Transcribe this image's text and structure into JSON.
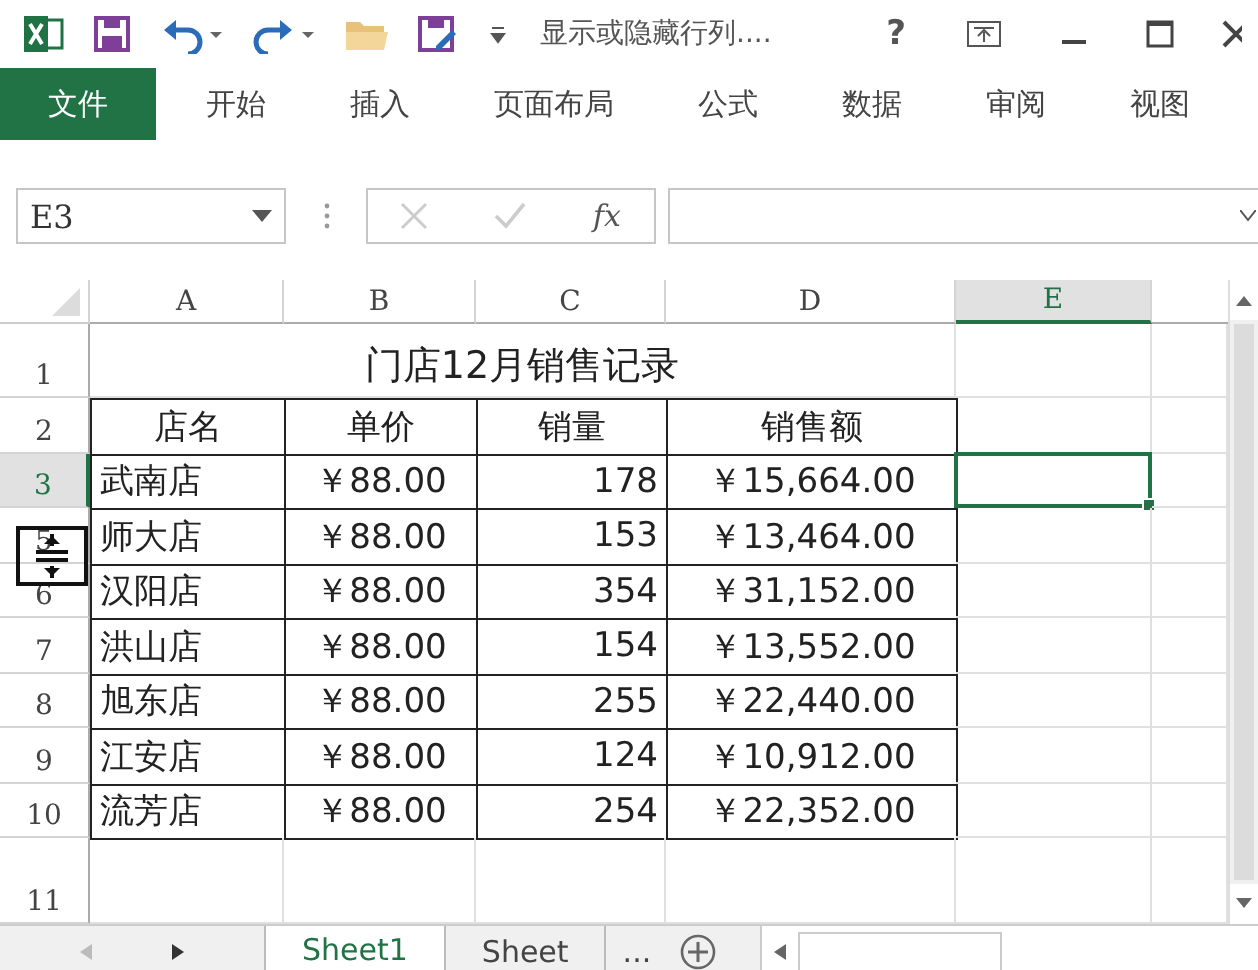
{
  "title_bar": {
    "title": "显示或隐藏行列....",
    "help": "?"
  },
  "ribbon_tabs": [
    {
      "label": "文件",
      "kind": "file",
      "selected": false
    },
    {
      "label": "开始",
      "kind": "tab",
      "selected": false
    },
    {
      "label": "插入",
      "kind": "tab",
      "selected": false
    },
    {
      "label": "页面布局",
      "kind": "tab",
      "selected": false
    },
    {
      "label": "公式",
      "kind": "tab",
      "selected": false
    },
    {
      "label": "数据",
      "kind": "tab",
      "selected": false
    },
    {
      "label": "审阅",
      "kind": "tab",
      "selected": false
    },
    {
      "label": "视图",
      "kind": "tab",
      "selected": false
    }
  ],
  "formula_bar": {
    "name_box": "E3",
    "function_label": "fx"
  },
  "columns": [
    {
      "label": "A",
      "selected": false
    },
    {
      "label": "B",
      "selected": false
    },
    {
      "label": "C",
      "selected": false
    },
    {
      "label": "D",
      "selected": false
    },
    {
      "label": "E",
      "selected": true
    }
  ],
  "rows": [
    {
      "header": "1",
      "selected": false,
      "title": "门店12月销售记录"
    },
    {
      "header": "2",
      "selected": false,
      "kind": "head",
      "cells": [
        "店名",
        "单价",
        "销量",
        "销售额"
      ]
    },
    {
      "header": "3",
      "selected": true,
      "cells": [
        "武南店",
        "￥88.00",
        "178",
        "￥15,664.00"
      ]
    },
    {
      "header": "5",
      "selected": false,
      "cells": [
        "师大店",
        "￥88.00",
        "153",
        "￥13,464.00"
      ]
    },
    {
      "header": "6",
      "selected": false,
      "cells": [
        "汉阳店",
        "￥88.00",
        "354",
        "￥31,152.00"
      ]
    },
    {
      "header": "7",
      "selected": false,
      "cells": [
        "洪山店",
        "￥88.00",
        "154",
        "￥13,552.00"
      ]
    },
    {
      "header": "8",
      "selected": false,
      "cells": [
        "旭东店",
        "￥88.00",
        "255",
        "￥22,440.00"
      ]
    },
    {
      "header": "9",
      "selected": false,
      "cells": [
        "江安店",
        "￥88.00",
        "124",
        "￥10,912.00"
      ]
    },
    {
      "header": "10",
      "selected": false,
      "cells": [
        "流芳店",
        "￥88.00",
        "254",
        "￥22,352.00"
      ]
    },
    {
      "header": "11",
      "selected": false
    }
  ],
  "sheet_tabs": [
    {
      "label": "Sheet1",
      "selected": true
    },
    {
      "label": "Sheet",
      "selected": false
    }
  ],
  "more_sheets": "..."
}
